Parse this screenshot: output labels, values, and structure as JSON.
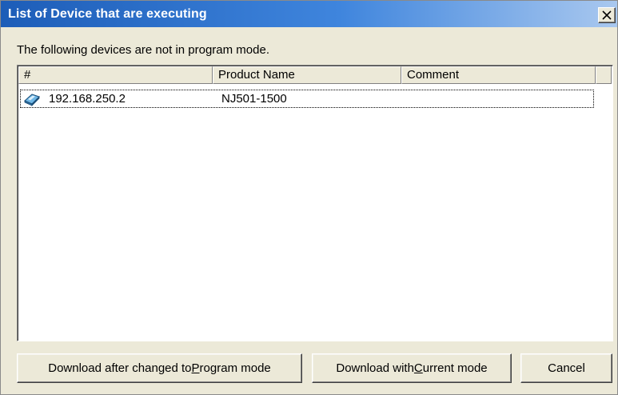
{
  "dialog": {
    "title": "List of Device that are executing",
    "close_label": "×"
  },
  "message": "The following devices are not in program mode.",
  "list": {
    "columns": [
      "#",
      "Product Name",
      "Comment"
    ],
    "rows": [
      {
        "icon": "controller-device-icon",
        "address": "192.168.250.2",
        "product": "NJ501-1500",
        "comment": ""
      }
    ]
  },
  "buttons": {
    "program_mode": {
      "before": "Download after changed to ",
      "mnemonic": "P",
      "after": "rogram mode"
    },
    "current_mode": {
      "before": "Download with ",
      "mnemonic": "C",
      "after": "urrent mode"
    },
    "cancel": "Cancel"
  },
  "colors": {
    "title_start": "#1d5db8",
    "title_end": "#a9c8ef",
    "dialog_bg": "#ece9d8"
  }
}
